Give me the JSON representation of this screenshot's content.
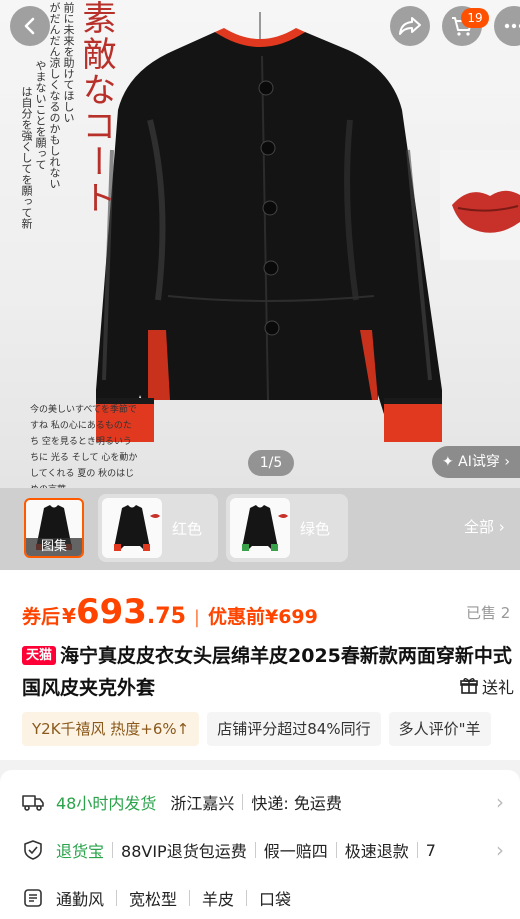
{
  "gallery": {
    "headline": "素敵なコート",
    "poem_lines": [
      "前に未来を助けてほしい",
      "がだんだん涼しくなるのかもしれない",
      "やまないことを願って",
      "は自分を強くしてを願って新"
    ],
    "poem_small": "今の美しいすべてを季節ですね 私の心にあるものたち 空を見るとき明るいうちに 光る そして 心を動かしてくれる 夏の 秋のはじめの言葉",
    "pager": "1/5",
    "ai_tryon": "✦ AI试穿 ›",
    "cart_count": "19",
    "thumbs": [
      {
        "label": "图集"
      },
      {
        "label": "红色"
      },
      {
        "label": "绿色"
      }
    ],
    "all_label": "全部 ›",
    "colors": {
      "accent": "#ff5000",
      "lining_red": "#e0391f",
      "lining_green": "#3aa14a"
    }
  },
  "price": {
    "coupon_label": "券后",
    "currency": "¥",
    "integer": "693",
    "decimal": ".75",
    "separator": "|",
    "pre_label": "优惠前¥699",
    "sold": "已售 2"
  },
  "product": {
    "shop_badge": "天猫",
    "title": "海宁真皮皮衣女头层绵羊皮2025春新款两面穿新中式国风皮夹克外套",
    "gift_label": "送礼"
  },
  "chips": [
    "Y2K千禧风 热度+6%↑",
    "店铺评分超过84%同行",
    "多人评价\"羊"
  ],
  "service": {
    "shipping": {
      "time": "48小时内发货",
      "origin": "浙江嘉兴",
      "courier": "快递: 免运费"
    },
    "guarantee": {
      "name": "退货宝",
      "items": [
        "88VIP退货包运费",
        "假一赔四",
        "极速退款",
        "7"
      ]
    },
    "attrs": [
      "通勤风",
      "宽松型",
      "羊皮",
      "口袋"
    ]
  }
}
